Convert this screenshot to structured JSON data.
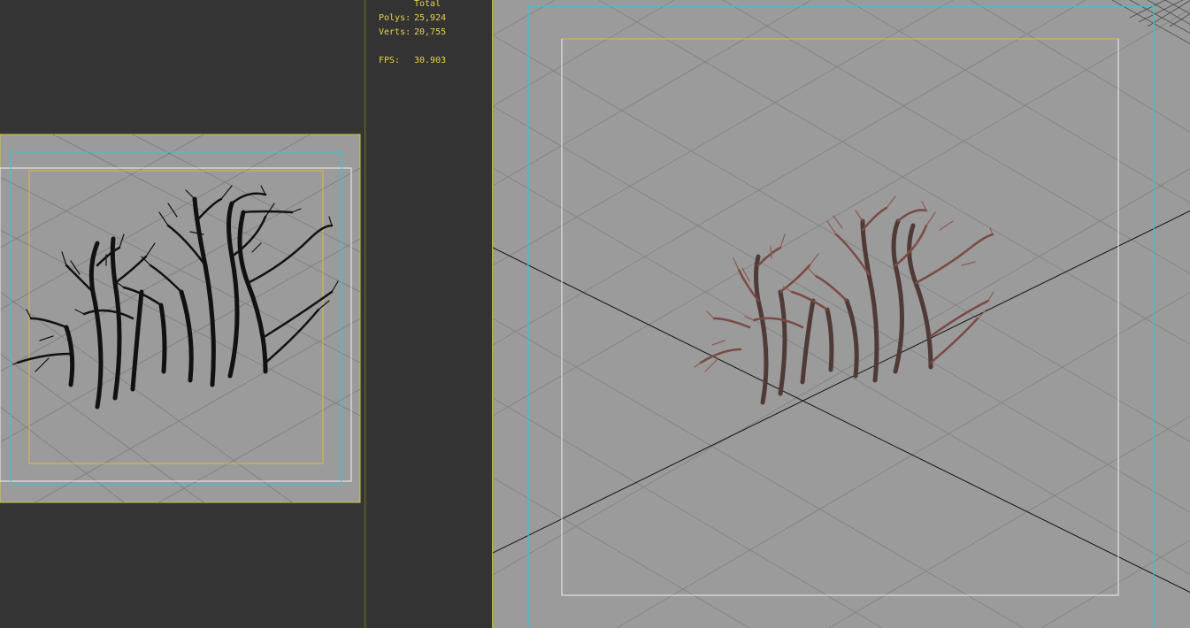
{
  "stats": {
    "total_label": "Total",
    "polys_label": "Polys:",
    "polys_value": "25,924",
    "verts_label": "Verts:",
    "verts_value": "20,755",
    "fps_label": "FPS:",
    "fps_value": "30.903"
  },
  "colors": {
    "viewport_bg": "#9b9b9b",
    "ui_bg": "#353535",
    "active_border": "#d8c838",
    "safe_frame_cyan": "#30c8d8",
    "safe_frame_yellow": "#e0b840",
    "safe_frame_white": "#f0f0f0",
    "stats_text": "#e8d24a",
    "wire_branches": "#111111",
    "shaded_branches": "#5a3a34"
  }
}
